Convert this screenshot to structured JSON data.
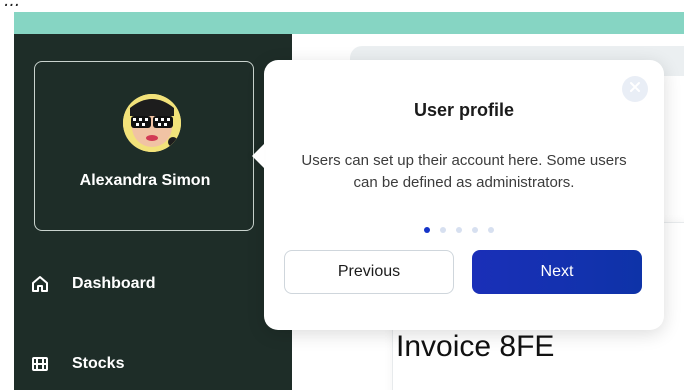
{
  "caption": "...",
  "sidebar": {
    "profile": {
      "name": "Alexandra Simon"
    },
    "items": [
      {
        "label": "Dashboard",
        "icon": "home-icon"
      },
      {
        "label": "Stocks",
        "icon": "stocks-icon"
      }
    ]
  },
  "main": {
    "invoice_title": "Invoice 8FE"
  },
  "popover": {
    "title": "User profile",
    "body": "Users can set up their account here. Some users can be defined as administrators.",
    "step": 1,
    "steps": 5,
    "previous_label": "Previous",
    "next_label": "Next"
  },
  "colors": {
    "top_band": "#86d5c3",
    "sidebar": "#1e2d28",
    "primary": "#1534c8"
  }
}
